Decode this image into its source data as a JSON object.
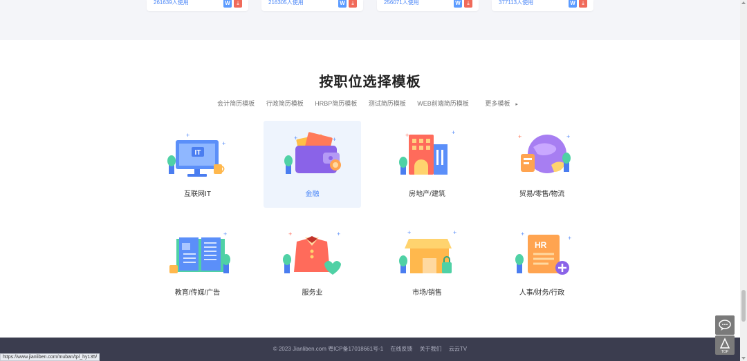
{
  "top_cards": [
    {
      "count": "261639人使用",
      "word_icon": "W",
      "pdf_icon": "PDF"
    },
    {
      "count": "216305人使用",
      "word_icon": "W",
      "pdf_icon": "PDF"
    },
    {
      "count": "256071人使用",
      "word_icon": "W",
      "pdf_icon": "PDF"
    },
    {
      "count": "377113人使用",
      "word_icon": "W",
      "pdf_icon": "PDF"
    }
  ],
  "section": {
    "title": "按职位选择模板",
    "tabs": [
      "会计简历模板",
      "行政简历模板",
      "HRBP简历模板",
      "测试简历模板",
      "WEB前端简历模板",
      "更多模板"
    ],
    "more_arrow": "▸"
  },
  "categories": [
    {
      "label": "互联网IT",
      "icon": "monitor-it-icon",
      "active": false
    },
    {
      "label": "金融",
      "icon": "wallet-icon",
      "active": true
    },
    {
      "label": "房地产/建筑",
      "icon": "buildings-icon",
      "active": false
    },
    {
      "label": "贸易/零售/物流",
      "icon": "globe-trade-icon",
      "active": false
    },
    {
      "label": "教育/传媒/广告",
      "icon": "open-book-icon",
      "active": false
    },
    {
      "label": "服务业",
      "icon": "waiter-uniform-icon",
      "active": false
    },
    {
      "label": "市场/销售",
      "icon": "storefront-icon",
      "active": false
    },
    {
      "label": "人事/财务/行政",
      "icon": "hr-document-icon",
      "active": false
    }
  ],
  "footer": {
    "copyright": "© 2023 Jianliben.com 粤ICP备17018661号-1",
    "links": [
      "在线反馈",
      "关于我们",
      "云云TV"
    ]
  },
  "float": {
    "top_label": "TOP"
  },
  "status_url": "https://www.jianliben.com/muban/tpl_hy135/",
  "colors": {
    "accent": "#4a86f7",
    "footer_bg": "#3b3d4f",
    "active_bg": "#eef4fd"
  }
}
